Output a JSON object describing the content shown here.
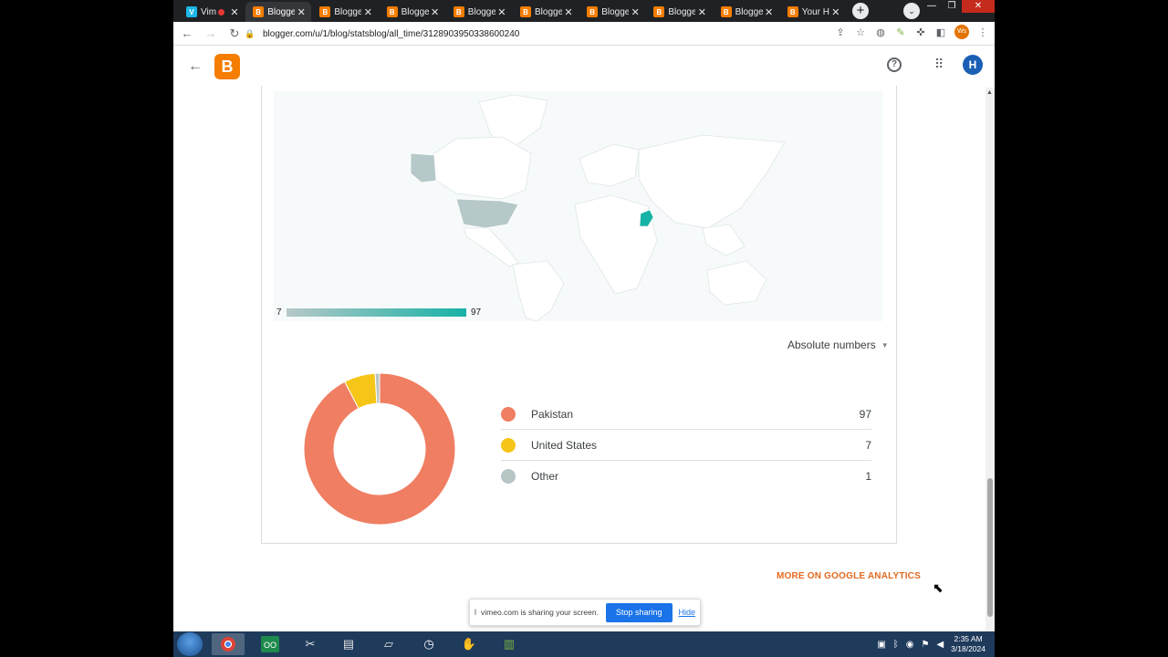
{
  "browser": {
    "tabs": [
      {
        "label": "Vim",
        "favicon": "V",
        "kind": "vimeo",
        "recording": true,
        "active": false
      },
      {
        "label": "Blogge",
        "favicon": "B",
        "kind": "blogger",
        "recording": false,
        "active": true
      },
      {
        "label": "Blogge",
        "favicon": "B",
        "kind": "blogger",
        "recording": false,
        "active": false
      },
      {
        "label": "Blogge",
        "favicon": "B",
        "kind": "blogger",
        "recording": false,
        "active": false
      },
      {
        "label": "Blogge",
        "favicon": "B",
        "kind": "blogger",
        "recording": false,
        "active": false
      },
      {
        "label": "Blogge",
        "favicon": "B",
        "kind": "blogger",
        "recording": false,
        "active": false
      },
      {
        "label": "Blogge",
        "favicon": "B",
        "kind": "blogger",
        "recording": false,
        "active": false
      },
      {
        "label": "Blogge",
        "favicon": "B",
        "kind": "blogger",
        "recording": false,
        "active": false
      },
      {
        "label": "Blogge",
        "favicon": "B",
        "kind": "blogger",
        "recording": false,
        "active": false
      },
      {
        "label": "Your H",
        "favicon": "B",
        "kind": "blogger",
        "recording": false,
        "active": false
      }
    ],
    "url": "blogger.com/u/1/blog/statsblog/all_time/3128903950338600240",
    "extension_badge": "Ws"
  },
  "header": {
    "logo_letter": "B",
    "avatar_letter": "H"
  },
  "map_legend": {
    "min": "7",
    "max": "97"
  },
  "metric_select": {
    "selected": "Absolute numbers"
  },
  "chart_data": {
    "type": "pie",
    "donut": true,
    "labels": [
      "Pakistan",
      "United States",
      "Other"
    ],
    "values": [
      97,
      7,
      1
    ],
    "colors": [
      "#f07e62",
      "#f5c518",
      "#b8c5c5"
    ]
  },
  "countries": [
    {
      "name": "Pakistan",
      "value": "97",
      "color": "#f07e62"
    },
    {
      "name": "United States",
      "value": "7",
      "color": "#f5c518"
    },
    {
      "name": "Other",
      "value": "1",
      "color": "#b8c5c5"
    }
  ],
  "links": {
    "more_analytics": "MORE ON GOOGLE ANALYTICS"
  },
  "screen_share": {
    "message": "vimeo.com is sharing your screen.",
    "stop_label": "Stop sharing",
    "hide_label": "Hide"
  },
  "taskbar": {
    "time": "2:35 AM",
    "date": "3/18/2024"
  },
  "colors": {
    "blogger_orange": "#f57d00",
    "map_highlight": "#17b2a6",
    "link_orange": "#e36a20"
  }
}
